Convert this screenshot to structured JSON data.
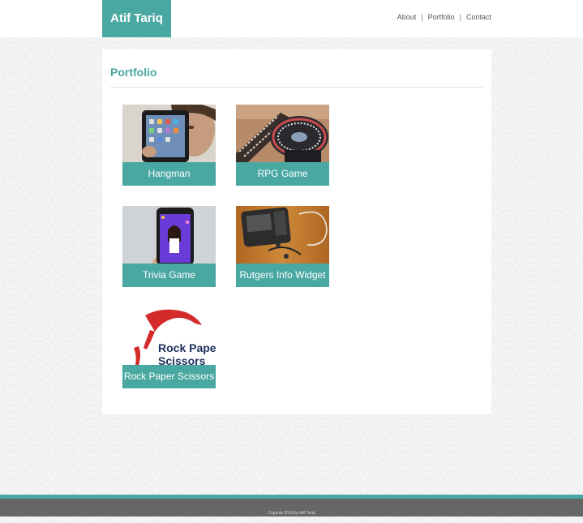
{
  "header": {
    "brand": "Atif Tariq",
    "nav": [
      {
        "label": "About"
      },
      {
        "label": "Portfolio"
      },
      {
        "label": "Contact"
      }
    ],
    "separator": "|"
  },
  "main": {
    "title": "Portfolio",
    "projects": [
      {
        "label": "Hangman",
        "image": "tablet-photo"
      },
      {
        "label": "RPG Game",
        "image": "turntable-photo"
      },
      {
        "label": "Trivia Game",
        "image": "smartphone-photo"
      },
      {
        "label": "Rutgers Info Widget",
        "image": "phone-earphones-photo"
      },
      {
        "label": "Rock Paper Scissors",
        "image": "rock-paper-scissors-logo"
      }
    ]
  },
  "footer": {
    "copyright": "Copyrite 2019 by Atif Tariq"
  },
  "colors": {
    "accent": "#4aa8a2",
    "footer": "#666666",
    "background": "#f0f1f3"
  }
}
